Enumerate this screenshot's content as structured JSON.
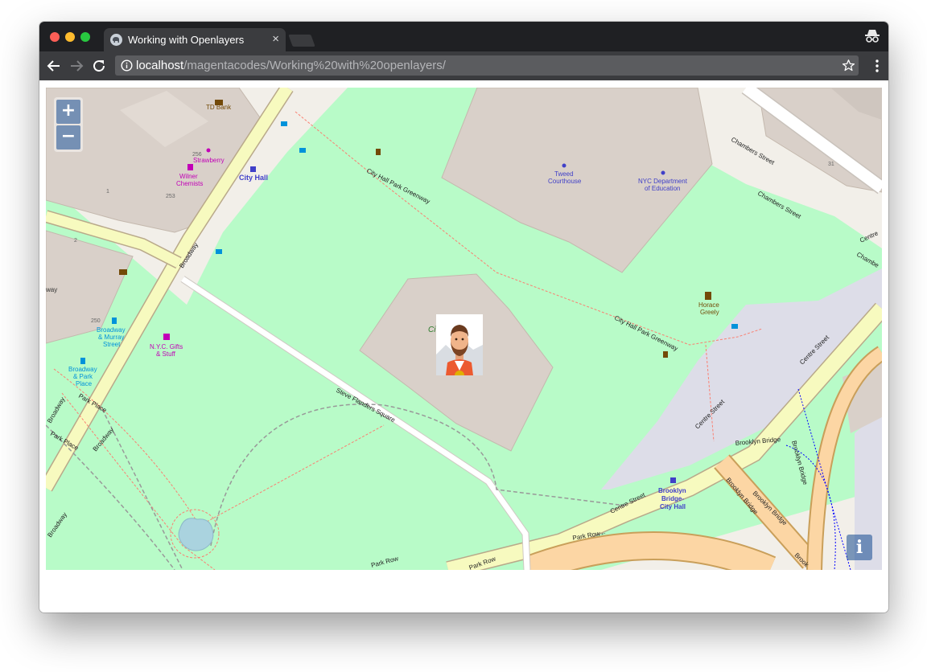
{
  "browser": {
    "tab_title": "Working with Openlayers",
    "tab_close": "×",
    "url_host": "localhost",
    "url_path": "/magentacodes/Working%20with%20openlayers/"
  },
  "map": {
    "zoom_in": "+",
    "zoom_out": "−",
    "attribution": "i",
    "labels": {
      "td_bank": "TD Bank",
      "n256": "256",
      "strawberry": "Strawberry",
      "wilner1": "Wilner",
      "wilner2": "Chemists",
      "n253": "253",
      "n2": "2",
      "n1": "1",
      "city_hall": "City Hall",
      "way": "way",
      "n250": "250",
      "bm1": "Broadway",
      "bm2": "& Murray",
      "bm3": "Street",
      "nyc_gifts1": "N.Y.C. Gifts",
      "nyc_gifts2": "& Stuff",
      "bp1": "Broadway",
      "bp2": "& Park",
      "bp3": "Place",
      "broadway": "Broadway",
      "park_place": "Park Place",
      "tweed1": "Tweed",
      "tweed2": "Courthouse",
      "doe1": "NYC Department",
      "doe2": "of Education",
      "chp_greenway": "City Hall Park Greenway",
      "chambers": "Chambers Street",
      "chambers_short": "Chambe",
      "n31": "31",
      "centre_short": "Centre",
      "horace1": "Horace",
      "horace2": "Greely",
      "city_hall_short": "Cit",
      "steve": "Steve Flanders Square",
      "centre": "Centre Street",
      "bbcity1": "Brooklyn",
      "bbcity2": "Bridge-",
      "bbcity3": "City Hall",
      "bbridge": "Brooklyn Bridge",
      "park_row": "Park Row",
      "park_row_arrow": "Park Row←",
      "brook_short": "Brook"
    }
  }
}
